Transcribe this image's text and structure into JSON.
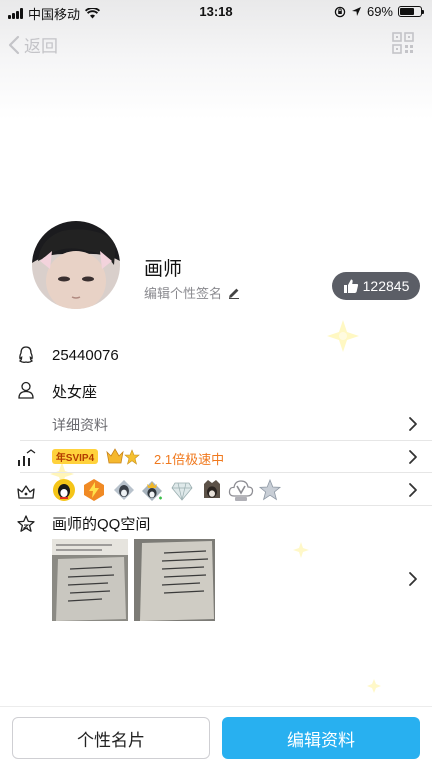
{
  "status_bar": {
    "carrier": "中国移动",
    "time": "13:18",
    "battery": "69%",
    "battery_level": 0.69
  },
  "nav": {
    "back_label": "返回"
  },
  "profile": {
    "nickname": "画师",
    "signature_placeholder": "编辑个性签名",
    "like_count": "122845"
  },
  "info": {
    "qq_number": "25440076",
    "zodiac": "处女座",
    "detail_label": "详细资料"
  },
  "vip": {
    "badge": "年SVIP4",
    "speed_text": "2.1倍极速中"
  },
  "medals": {
    "icons": [
      "qq-penguin-medal",
      "lightning-medal",
      "silver-penguin-medal",
      "crown-penguin-medal",
      "diamond-medal",
      "dark-penguin-medal",
      "v-cloud-medal",
      "star-medal"
    ]
  },
  "qzone": {
    "title": "画师的QQ空间"
  },
  "actions": {
    "card_button": "个性名片",
    "edit_button": "编辑资料"
  },
  "colors": {
    "accent": "#28b0f0",
    "vip_orange": "#f0791e",
    "like_pill": "#5b5e66"
  }
}
